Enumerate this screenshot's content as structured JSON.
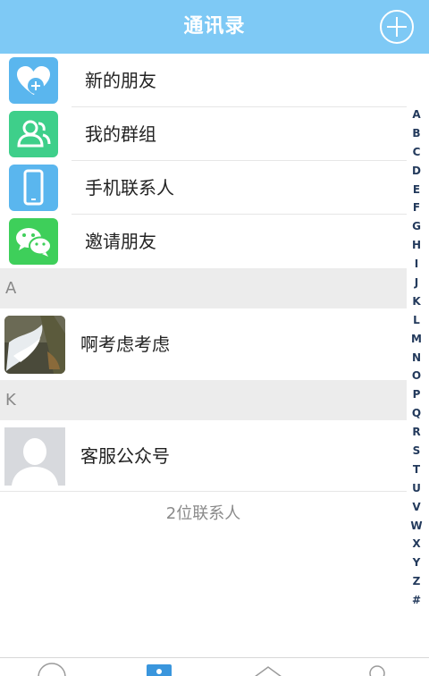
{
  "header": {
    "title": "通讯录"
  },
  "quick_items": [
    {
      "label": "新的朋友",
      "icon": "heart-plus-icon",
      "color": "#5ab6ee"
    },
    {
      "label": "我的群组",
      "icon": "group-icon",
      "color": "#3ecf8a"
    },
    {
      "label": "手机联系人",
      "icon": "phone-icon",
      "color": "#5ab6ee"
    },
    {
      "label": "邀请朋友",
      "icon": "wechat-icon",
      "color": "#3ecf5a"
    }
  ],
  "sections": [
    {
      "letter": "A",
      "contacts": [
        {
          "name": "啊考虑考虑"
        }
      ]
    },
    {
      "letter": "K",
      "contacts": [
        {
          "name": "客服公众号"
        }
      ]
    }
  ],
  "contact_count": "2位联系人",
  "index_letters": [
    "A",
    "B",
    "C",
    "D",
    "E",
    "F",
    "G",
    "H",
    "I",
    "J",
    "K",
    "L",
    "M",
    "N",
    "O",
    "P",
    "Q",
    "R",
    "S",
    "T",
    "U",
    "V",
    "W",
    "X",
    "Y",
    "Z",
    "#"
  ],
  "colors": {
    "header": "#7ec9f5",
    "section_bg": "#ececec",
    "index_text": "#233a5c"
  }
}
